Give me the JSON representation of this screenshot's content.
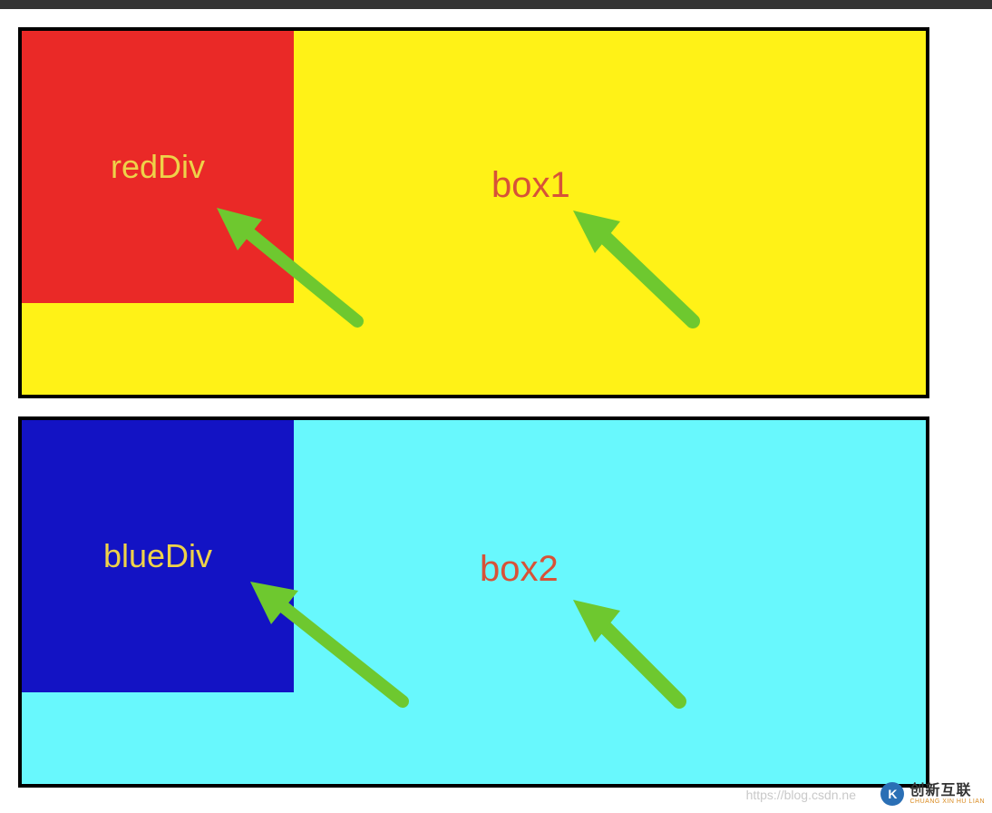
{
  "diagram": {
    "box1": {
      "label": "box1",
      "inner_label": "redDiv",
      "bg_color": "#fff217",
      "inner_color": "#ea2927"
    },
    "box2": {
      "label": "box2",
      "inner_label": "blueDiv",
      "bg_color": "#68f8fd",
      "inner_color": "#1313c4"
    },
    "arrow_color": "#6ec82f"
  },
  "watermark": {
    "logo_letter": "K",
    "main": "创新互联",
    "sub": "CHUANG XIN HU LIAN",
    "footer_text": "https://blog.csdn.ne"
  }
}
